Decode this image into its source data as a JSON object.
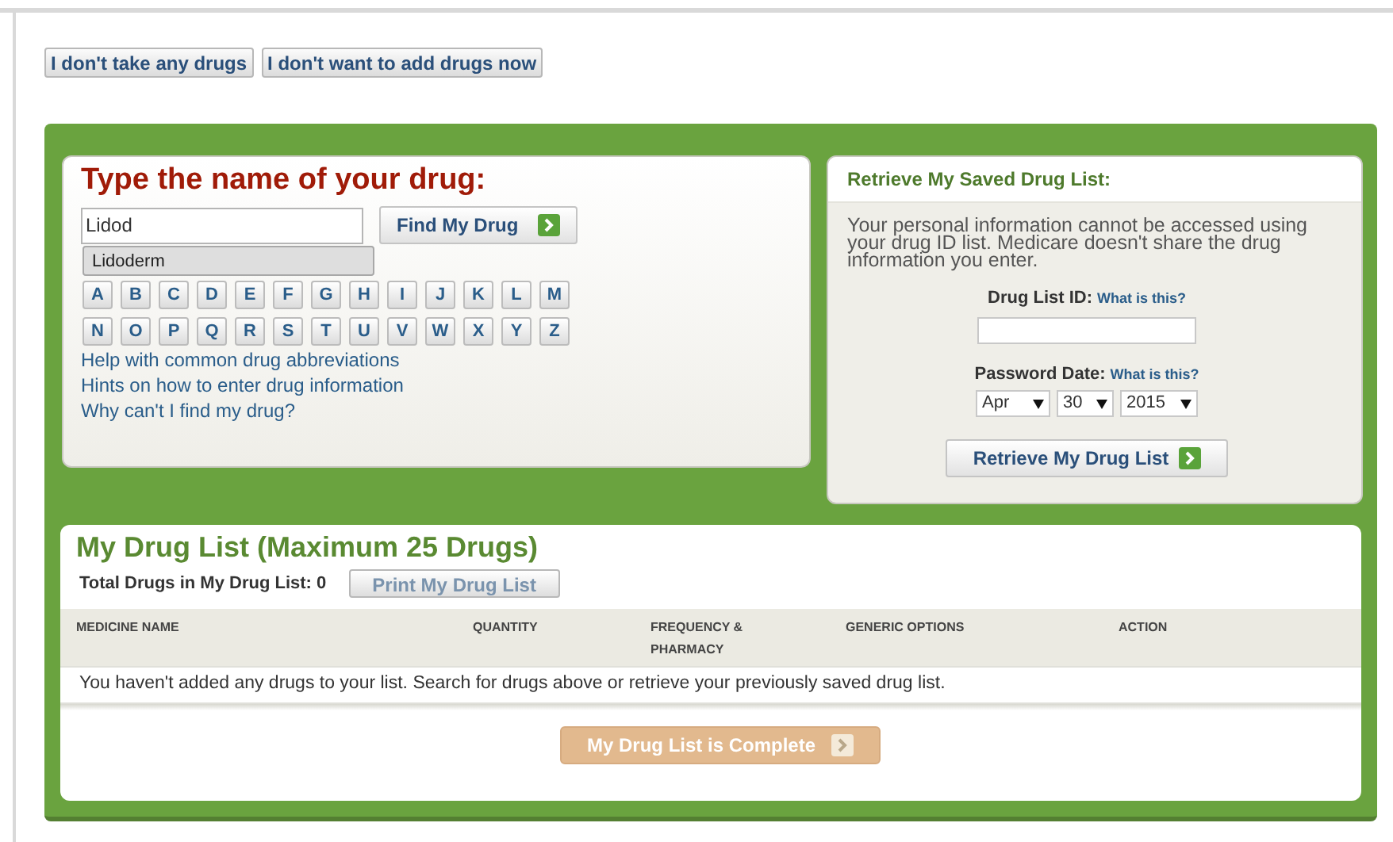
{
  "top_buttons": [
    {
      "label": "I don't take any drugs"
    },
    {
      "label": "I don't want to add drugs now"
    }
  ],
  "search": {
    "title": "Type the name of your drug:",
    "value": "Lidod",
    "button": "Find My Drug",
    "suggestions": [
      {
        "label": "Lidoderm",
        "selected": true
      }
    ],
    "letters": [
      [
        "A",
        "B",
        "C",
        "D",
        "E",
        "F",
        "G",
        "H",
        "I",
        "J",
        "K",
        "L",
        "M"
      ],
      [
        "N",
        "O",
        "P",
        "Q",
        "R",
        "S",
        "T",
        "U",
        "V",
        "W",
        "X",
        "Y",
        "Z"
      ]
    ],
    "links": [
      "Help with common drug abbreviations",
      "Hints on how to enter drug information",
      "Why can't I find my drug?"
    ]
  },
  "retrieve": {
    "title": "Retrieve My Saved Drug List:",
    "info": "Your personal information cannot be accessed using your drug ID list. Medicare doesn't share the drug information you enter.",
    "id_label": "Drug List ID:",
    "id_help": "What is this?",
    "date_label": "Password Date:",
    "date_help": "What is this?",
    "month": "Apr",
    "day": "30",
    "year": "2015",
    "button": "Retrieve My Drug List"
  },
  "drug_list": {
    "title": "My Drug List (Maximum 25 Drugs)",
    "total": "Total Drugs in My Drug List: 0",
    "print_button": {
      "label": "Print My Drug List",
      "disabled": true
    },
    "columns": [
      "MEDICINE NAME",
      "QUANTITY",
      "FREQUENCY & PHARMACY",
      "GENERIC OPTIONS",
      "ACTION"
    ],
    "empty_message": "You haven't added any drugs to your list. Search for drugs above or retrieve your previously saved drug list.",
    "complete_button": {
      "label": "My Drug List is Complete",
      "disabled": true
    }
  }
}
